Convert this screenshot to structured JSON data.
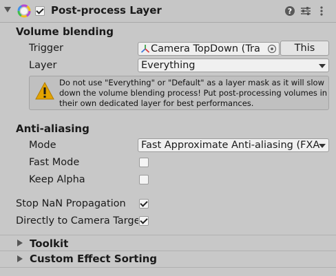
{
  "header": {
    "title": "Post-process Layer",
    "enabled": true,
    "icons": [
      "help-icon",
      "presets-icon",
      "more-options-icon"
    ]
  },
  "volume_blending": {
    "title": "Volume blending",
    "trigger_label": "Trigger",
    "trigger_value": "Camera TopDown (Tra",
    "this_button": "This",
    "layer_label": "Layer",
    "layer_value": "Everything",
    "warning": "Do not use \"Everything\" or \"Default\" as a layer mask as it will slow down the volume blending process! Put post-processing volumes in their own dedicated layer for best performances."
  },
  "anti_aliasing": {
    "title": "Anti-aliasing",
    "mode_label": "Mode",
    "mode_value": "Fast Approximate Anti-aliasing (FXA",
    "fast_mode_label": "Fast Mode",
    "fast_mode": false,
    "keep_alpha_label": "Keep Alpha",
    "keep_alpha": false
  },
  "options": {
    "stop_nan_label": "Stop NaN Propagation",
    "stop_nan": true,
    "direct_label": "Directly to Camera Targe",
    "direct": true
  },
  "foldouts": {
    "toolkit": "Toolkit",
    "custom_effect_sorting": "Custom Effect Sorting"
  },
  "colors": {
    "background": "#c8c8c8",
    "warning_icon": "#e2a300"
  }
}
